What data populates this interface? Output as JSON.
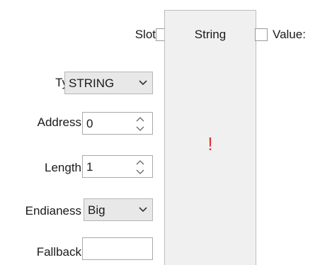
{
  "node": {
    "title": "String",
    "warning": "!",
    "ports": {
      "slot_label": "Slot",
      "value_label": "Value:"
    }
  },
  "properties": {
    "type": {
      "label": "Type",
      "value": "STRING"
    },
    "address": {
      "label": "Address",
      "value": "0"
    },
    "length": {
      "label": "Length",
      "value": "1"
    },
    "endianess": {
      "label": "Endianess",
      "value": "Big"
    },
    "fallback": {
      "label": "Fallback",
      "value": ""
    }
  },
  "colors": {
    "warning": "#e03030",
    "node_background": "#f0f0f0",
    "select_background": "#e8e8e8"
  },
  "icons": {
    "dropdown": "chevron-down-icon",
    "spinner": "spinner-arrows-icon"
  }
}
